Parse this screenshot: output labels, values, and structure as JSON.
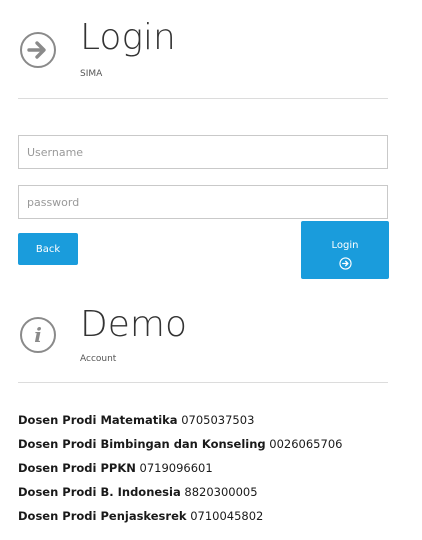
{
  "login_section": {
    "title": "Login",
    "subtitle": "SIMA",
    "icon": "arrow-right-circle-icon"
  },
  "form": {
    "username": {
      "placeholder": "Username",
      "value": ""
    },
    "password": {
      "placeholder": "password",
      "value": ""
    },
    "back_label": "Back",
    "login_label": "Login",
    "accent_color": "#1a9cdc"
  },
  "demo_section": {
    "title": "Demo",
    "subtitle": "Account",
    "icon": "info-circle-icon"
  },
  "accounts": [
    {
      "name": "Dosen Prodi Matematika",
      "code": "0705037503"
    },
    {
      "name": "Dosen Prodi Bimbingan dan Konseling",
      "code": "0026065706"
    },
    {
      "name": "Dosen Prodi PPKN",
      "code": "0719096601"
    },
    {
      "name": "Dosen Prodi B. Indonesia",
      "code": "8820300005"
    },
    {
      "name": "Dosen Prodi Penjaskesrek",
      "code": "0710045802"
    }
  ]
}
